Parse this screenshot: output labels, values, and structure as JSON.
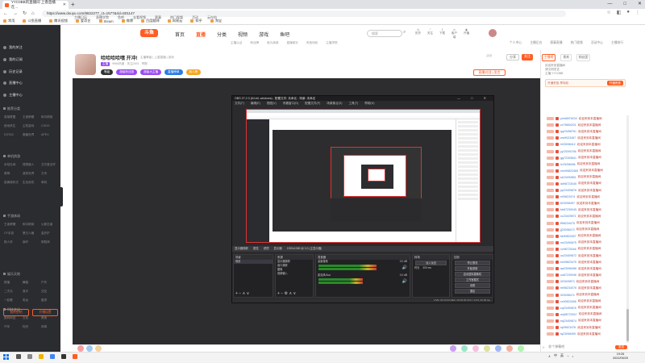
{
  "browser": {
    "tab_title": "YYC0BB的直播间 上香直播在...",
    "url": "https://www.douyu.com/8822277_ct=1577&rid=801147",
    "bookmarks": [
      "常用",
      "斗鱼直播",
      "腾讯视频",
      "爱奇艺",
      "Steam",
      "微博",
      "百度翻译",
      "网易云",
      "知乎",
      "淘宝"
    ],
    "window_controls": [
      "—",
      "□",
      "✕"
    ]
  },
  "site": {
    "logo": "斗鱼",
    "subnav_left": [
      "主播日历",
      "直播学院",
      "鱼吧",
      "去看视频",
      "赛事",
      "热门视频",
      "活动",
      "云存档"
    ],
    "main_nav": [
      {
        "label": "首页",
        "active": false
      },
      {
        "label": "直播",
        "active": true
      },
      {
        "label": "分类",
        "active": false
      },
      {
        "label": "视频",
        "active": false
      },
      {
        "label": "游戏",
        "active": false
      },
      {
        "label": "鱼吧",
        "active": false
      }
    ],
    "search_placeholder": "搜索",
    "header_icons": [
      "历史",
      "关注",
      "下载",
      "客户端",
      "开播"
    ],
    "subnav_right": [
      "个人中心",
      "主播后台",
      "赛事直播",
      "热门视频",
      "活动中心",
      "主播排行"
    ],
    "subnav_mid": [
      "主播认证",
      "粉丝牌",
      "鱼丸商城",
      "直播助手",
      "贵族特权",
      "主播学院"
    ]
  },
  "sidebar": {
    "top_items": [
      "我的关注",
      "我的订阅",
      "历史记录",
      "直播中心",
      "主播中心"
    ],
    "sections": [
      {
        "title": "推荐分类",
        "items": [
          "英雄联盟",
          "王者荣耀",
          "和平精英",
          "绝地求生",
          "主机游戏",
          "CSGO",
          "DOTA2",
          "魔兽世界",
          "APEX"
        ]
      },
      {
        "title": "单机热游",
        "items": [
          "永劫无间",
          "怪物猎人",
          "艾尔登法环",
          "原神",
          "我的世界",
          "方舟",
          "逃离塔科夫",
          "生化危机",
          "单机"
        ]
      },
      {
        "title": "手游休闲",
        "items": [
          "王者荣耀",
          "和平精英",
          "火影忍者",
          "CF手游",
          "第五人格",
          "金铲铲",
          "狼人杀",
          "崩坏",
          "阴阳师"
        ]
      },
      {
        "title": "娱乐天地",
        "items": [
          "颜值",
          "舞蹈",
          "户外",
          "二次元",
          "音乐",
          "交友",
          "一起看",
          "电台",
          "星秀"
        ]
      },
      {
        "title": "科技文化",
        "items": [
          "数码科技",
          "文化",
          "美食",
          "汽车",
          "知识",
          "体育"
        ]
      }
    ],
    "buttons": [
      "我的鱼吧",
      "开播设置"
    ]
  },
  "room": {
    "title": "哈哈哈哈嘿 开冲!",
    "category_meta": "主播等级 | 上香直播 | 游戏",
    "tags": [
      "主播",
      "9966热度",
      "关注2491",
      "举报"
    ],
    "badges": [
      {
        "label": "等级",
        "color": "#333333"
      },
      {
        "label": "超级粉丝团",
        "color": "#9b4df0"
      },
      {
        "label": "超级大主播",
        "color": "#9b4df0"
      },
      {
        "label": "直播榜单",
        "color": "#2d7be0"
      },
      {
        "label": "新人榜",
        "color": "#f5a623"
      }
    ],
    "right_buttons": [
      "分享",
      "关注"
    ],
    "gift_button": "直播对战 | 发言",
    "corner_text": "活动"
  },
  "obs": {
    "title": "OBS 27.2.3 (64-bit, windows) - 配置文件: 未命名 - 场景: 未命名",
    "menu": [
      "文件(F)",
      "编辑(E)",
      "视图(V)",
      "停靠窗口(D)",
      "配置文件(P)",
      "场景集合(S)",
      "工具(T)",
      "帮助(H)"
    ],
    "status_bar": [
      "显示器捕获",
      "属性",
      "滤镜",
      "显示器",
      "1920x1080 @ 0,0 (主显示器)"
    ],
    "panels": {
      "scenes": {
        "header": "场景",
        "items": [
          "场景"
        ]
      },
      "sources": {
        "header": "来源",
        "items": [
          "显示器捕获",
          "窗口捕获",
          "图像",
          "音频输入"
        ]
      },
      "mixer": {
        "header": "混音器",
        "tracks": [
          {
            "label": "桌面音频",
            "value": "0.0 dB",
            "level": 0.72
          },
          {
            "label": "麦克风/Aux",
            "value": "0.0 dB",
            "level": 0.55
          }
        ]
      },
      "transitions": {
        "header": "转场",
        "type": "淡入淡出",
        "duration_label": "时长",
        "duration": "300 ms"
      },
      "controls": {
        "header": "控制",
        "buttons": [
          "停止推流",
          "开始录制",
          "启动虚拟摄像机",
          "工作室模式",
          "设置",
          "退出"
        ]
      }
    },
    "footer": "LIVE: 00:12:34  REC: 00:00:00  CPU: 3.4%, 60.00 fps"
  },
  "chat": {
    "tabs": [
      "主播榜",
      "贵宾",
      "粉丝团"
    ],
    "active_tab": "主播榜",
    "header_lines": [
      "欢迎来到直播间",
      "请文明发言",
      "主播:YYC0BB"
    ],
    "noble_text": "开通贵族 享特权",
    "noble_button": "开通贵族",
    "messages": [
      {
        "name": "ymh8976234",
        "text": "欢迎来到本直播间"
      },
      {
        "name": "zz78654201",
        "text": "欢迎来到本直播间"
      },
      {
        "name": "qq23498761",
        "text": "欢迎来到本直播间"
      },
      {
        "name": "ww9023487",
        "text": "欢迎来到本直播间"
      },
      {
        "name": "hl33098412",
        "text": "欢迎来到本直播间"
      },
      {
        "name": "yy23094756",
        "text": "欢迎来到本直播间"
      },
      {
        "name": "gg72309841",
        "text": "欢迎来到本直播间"
      },
      {
        "name": "lx23098456",
        "text": "欢迎来到本直播间"
      },
      {
        "name": "mm90823465",
        "text": "欢迎来到本直播间"
      },
      {
        "name": "sk23490851",
        "text": "欢迎来到本直播间"
      },
      {
        "name": "dd98723045",
        "text": "欢迎来到本直播间"
      },
      {
        "name": "pp23409876",
        "text": "欢迎来到本直播间"
      },
      {
        "name": "rr09823474",
        "text": "欢迎来到本直播间"
      },
      {
        "name": "tt23098457",
        "text": "欢迎来到本直播间"
      },
      {
        "name": "bb87230945",
        "text": "欢迎来到本直播间"
      },
      {
        "name": "cc23409871",
        "text": "欢迎来到本直播间"
      },
      {
        "name": "ff98234075",
        "text": "欢迎来到本直播间"
      },
      {
        "name": "jj23098473",
        "text": "欢迎来到本直播间"
      },
      {
        "name": "kk90823457",
        "text": "欢迎来到本直播间"
      },
      {
        "name": "nn23490875",
        "text": "欢迎来到本直播间"
      },
      {
        "name": "vv98723046",
        "text": "欢迎来到本直播间"
      },
      {
        "name": "uu23409872",
        "text": "欢迎来到本直播间"
      },
      {
        "name": "ee09823475",
        "text": "欢迎来到本直播间"
      },
      {
        "name": "aa23098458",
        "text": "欢迎来到本直播间"
      },
      {
        "name": "oo87230946",
        "text": "欢迎来到本直播间"
      },
      {
        "name": "ii23409873",
        "text": "欢迎来到本直播间"
      },
      {
        "name": "hh98234076",
        "text": "欢迎来到本直播间"
      },
      {
        "name": "ll23098474",
        "text": "欢迎来到本直播间"
      },
      {
        "name": "xx90823458",
        "text": "欢迎来到本直播间"
      },
      {
        "name": "zq23490876",
        "text": "欢迎来到本直播间"
      },
      {
        "name": "wq98723047",
        "text": "欢迎来到本直播间"
      },
      {
        "name": "eq23409874",
        "text": "欢迎来到本直播间"
      },
      {
        "name": "rq09823476",
        "text": "欢迎来到本直播间"
      },
      {
        "name": "tq23098459",
        "text": "欢迎来到本直播间"
      }
    ],
    "input_placeholder": "发个弹幕吧",
    "send_label": "发送"
  },
  "taskbar": {
    "tray": [
      "∧",
      "中",
      "英"
    ],
    "time": "19:26",
    "date": "2022/05/20"
  },
  "colors": {
    "accent": "#ff5d23",
    "sidebar_bg": "#2b2c30",
    "obs_bg": "#2b2b2e",
    "chat_name": "#3a7ad9",
    "chat_text": "#c0392b"
  }
}
